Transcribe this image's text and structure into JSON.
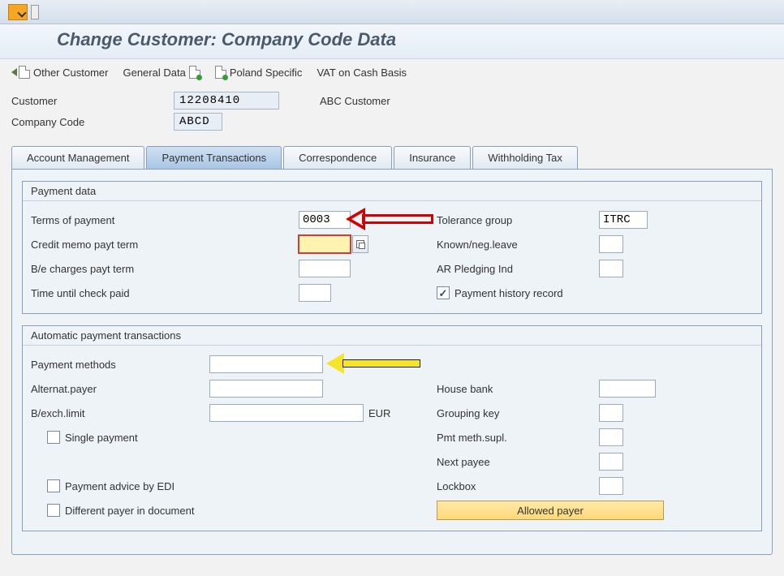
{
  "header": {
    "title": "Change Customer: Company Code Data"
  },
  "toolbar": {
    "other_customer": "Other Customer",
    "general_data": "General Data",
    "poland_specific": "Poland Specific",
    "vat_cash_basis": "VAT on Cash Basis"
  },
  "customer": {
    "id_label": "Customer",
    "id_value": "12208410",
    "name": "ABC Customer",
    "company_code_label": "Company Code",
    "company_code_value": "ABCD"
  },
  "tabs": {
    "account_management": "Account Management",
    "payment_transactions": "Payment Transactions",
    "correspondence": "Correspondence",
    "insurance": "Insurance",
    "withholding_tax": "Withholding Tax"
  },
  "payment_data": {
    "group_title": "Payment data",
    "terms_of_payment_label": "Terms of payment",
    "terms_of_payment_value": "0003",
    "credit_memo_label": "Credit memo payt term",
    "credit_memo_value": "",
    "be_charges_label": "B/e charges payt term",
    "be_charges_value": "",
    "time_check_label": "Time until check paid",
    "time_check_value": "",
    "tolerance_group_label": "Tolerance group",
    "tolerance_group_value": "ITRC",
    "known_neg_label": "Known/neg.leave",
    "known_neg_value": "",
    "ar_pledging_label": "AR Pledging Ind",
    "ar_pledging_value": "",
    "payment_history_label": "Payment history record",
    "payment_history_checked": true
  },
  "auto_payment": {
    "group_title": "Automatic payment transactions",
    "payment_methods_label": "Payment methods",
    "payment_methods_value": "",
    "alternat_payer_label": "Alternat.payer",
    "alternat_payer_value": "",
    "bexch_limit_label": "B/exch.limit",
    "bexch_limit_value": "",
    "bexch_limit_unit": "EUR",
    "single_payment_label": "Single payment",
    "payment_advice_edi_label": "Payment advice by EDI",
    "diff_payer_doc_label": "Different payer in document",
    "house_bank_label": "House bank",
    "house_bank_value": "",
    "grouping_key_label": "Grouping key",
    "grouping_key_value": "",
    "pmt_meth_supl_label": "Pmt meth.supl.",
    "pmt_meth_supl_value": "",
    "next_payee_label": "Next payee",
    "next_payee_value": "",
    "lockbox_label": "Lockbox",
    "lockbox_value": "",
    "allowed_payer_btn": "Allowed payer"
  }
}
